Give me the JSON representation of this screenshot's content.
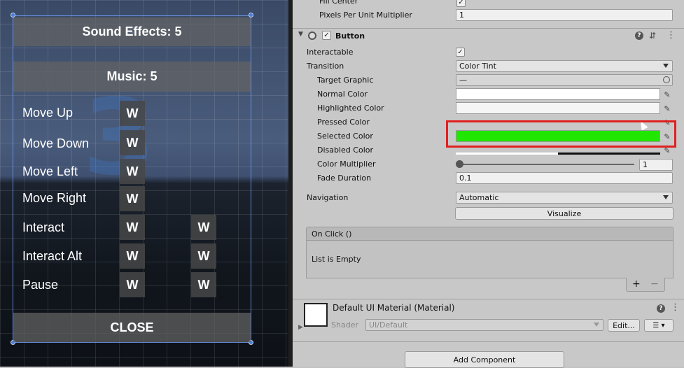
{
  "game": {
    "background_number": "3",
    "sound_effects": "Sound Effects: 5",
    "music": "Music: 5",
    "close": "CLOSE",
    "bindings": [
      {
        "label": "Move Up",
        "primary": "W",
        "secondary": ""
      },
      {
        "label": "Move Down",
        "primary": "W",
        "secondary": ""
      },
      {
        "label": "Move Left",
        "primary": "W",
        "secondary": ""
      },
      {
        "label": "Move Right",
        "primary": "W",
        "secondary": ""
      },
      {
        "label": "Interact",
        "primary": "W",
        "secondary": "W"
      },
      {
        "label": "Interact Alt",
        "primary": "W",
        "secondary": "W"
      },
      {
        "label": "Pause",
        "primary": "W",
        "secondary": "W"
      }
    ]
  },
  "inspector": {
    "fill_center_label": "Fill Center",
    "ppu_label": "Pixels Per Unit Multiplier",
    "ppu_value": "1",
    "component_title": "Button",
    "interactable_label": "Interactable",
    "transition_label": "Transition",
    "transition_value": "Color Tint",
    "target_graphic_label": "Target Graphic",
    "target_graphic_value": "—",
    "normal_color_label": "Normal Color",
    "highlighted_color_label": "Highlighted Color",
    "pressed_color_label": "Pressed Color",
    "selected_color_label": "Selected Color",
    "disabled_color_label": "Disabled Color",
    "color_multiplier_label": "Color Multiplier",
    "color_multiplier_value": "1",
    "fade_duration_label": "Fade Duration",
    "fade_duration_value": "0.1",
    "navigation_label": "Navigation",
    "navigation_value": "Automatic",
    "visualize_label": "Visualize",
    "onclick_header": "On Click ()",
    "onclick_empty": "List is Empty",
    "plus": "+",
    "minus": "−",
    "material_title": "Default UI Material (Material)",
    "shader_label": "Shader",
    "shader_value": "UI/Default",
    "edit_label": "Edit...",
    "add_component": "Add Component",
    "help_icon": "?",
    "settings_icon": "⇵",
    "menu_icon": "⋮",
    "colors": {
      "selected": "#21e600",
      "highlight_box": "#e02020"
    }
  }
}
